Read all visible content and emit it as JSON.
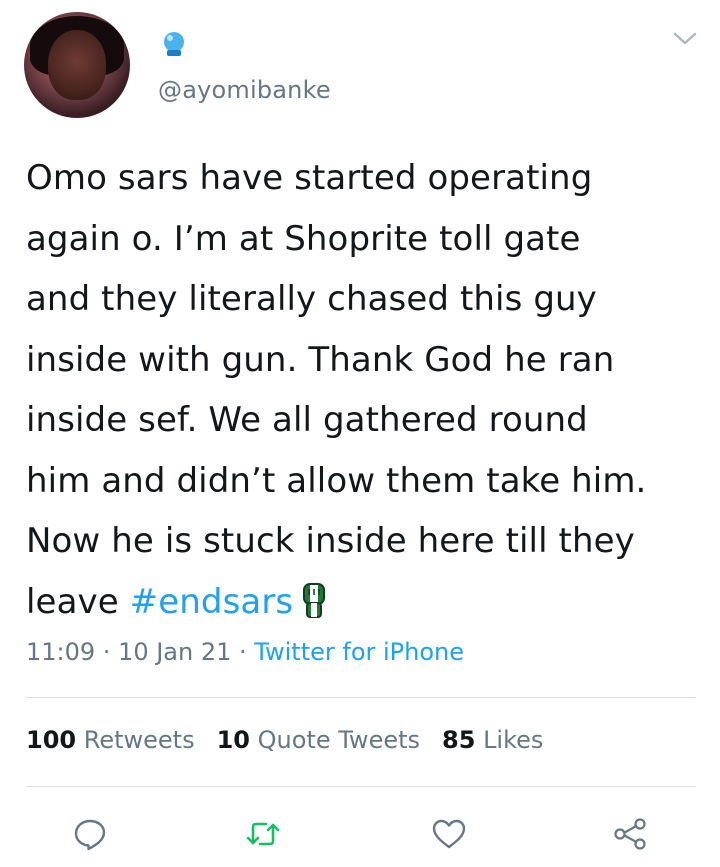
{
  "tweet": {
    "handle": "@ayomibanke",
    "text_before_hashtag": "Omo sars have started operating\nagain o. I’m at Shoprite toll gate\nand they literally chased this guy\ninside with gun. Thank God he ran\ninside sef. We all gathered round\nhim and didn’t allow them take him.\nNow he is stuck inside here till they\nleave ",
    "hashtag": "#endsars",
    "time": "11:09",
    "date": "10 Jan 21",
    "source": "Twitter for iPhone",
    "separator": " · "
  },
  "stats": {
    "retweets_count": "100",
    "retweets_label": "Retweets",
    "quote_count": "10",
    "quote_label": "Quote Tweets",
    "likes_count": "85",
    "likes_label": "Likes"
  },
  "icons": {
    "display_name_emoji": "crystal-ball-icon",
    "menu": "chevron-down-icon",
    "fist": "raised-fist-emoji",
    "reply": "reply-icon",
    "retweet": "retweet-icon",
    "like": "heart-icon",
    "share": "share-icon"
  },
  "colors": {
    "link": "#1da1f2",
    "muted": "#657786",
    "retweet_green": "#17bf63",
    "divider": "#d9dfe4"
  }
}
